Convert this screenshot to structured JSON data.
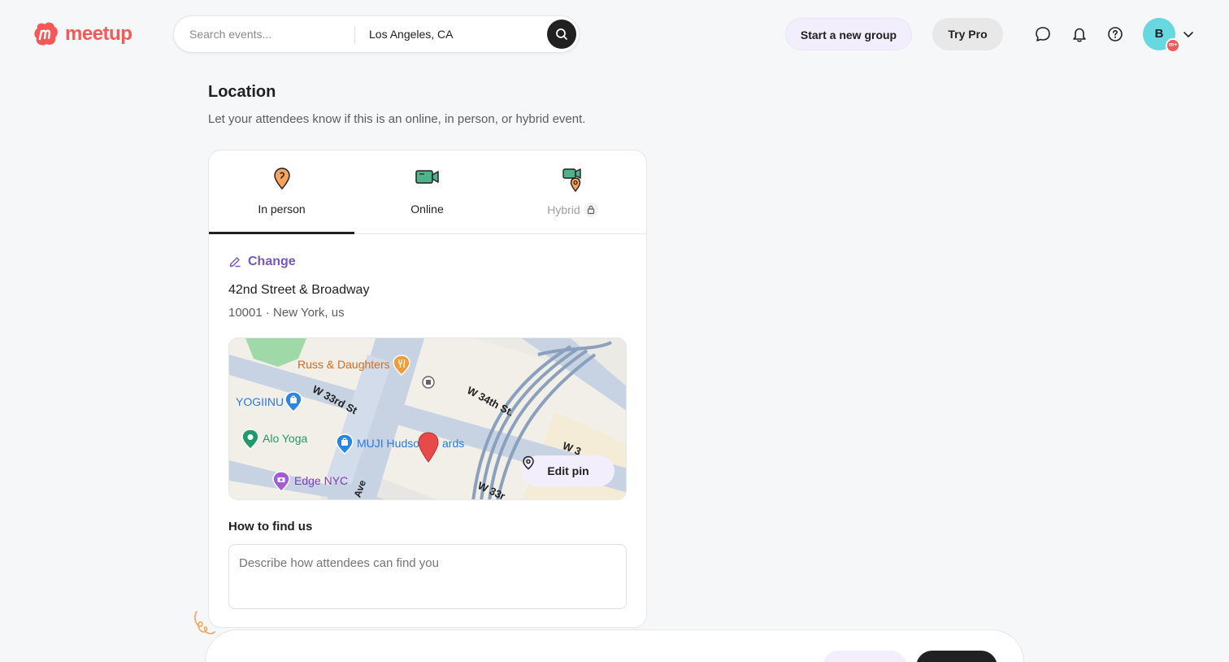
{
  "header": {
    "brand": "meetup",
    "search_placeholder": "Search events...",
    "location": "Los Angeles, CA",
    "start_group": "Start a new group",
    "try_pro": "Try Pro",
    "avatar_initial": "B",
    "avatar_badge": "m+"
  },
  "location_section": {
    "title": "Location",
    "subtitle": "Let your attendees know if this is an online, in person, or hybrid event.",
    "tabs": [
      {
        "label": "In person",
        "icon": "map-pin-icon",
        "active": true
      },
      {
        "label": "Online",
        "icon": "video-camera-icon",
        "active": false
      },
      {
        "label": "Hybrid",
        "icon": "hybrid-icon",
        "locked": true
      }
    ],
    "change_label": "Change",
    "address_line1": "42nd Street & Broadway",
    "address_line2": "10001 · New York, us",
    "map": {
      "labels": {
        "russ": "Russ & Daughters",
        "yogiinu": "YOGIINU",
        "alo": "Alo Yoga",
        "muji": "MUJI Hudso",
        "muji_tail": "ards",
        "edge": "Edge NYC",
        "w33": "W 33rd St",
        "w34": "W 34th St.",
        "w34b": "W 3",
        "w33b": "W 33r",
        "ave": "Ave"
      },
      "edit_pin": "Edit pin"
    },
    "find_us_title": "How to find us",
    "find_us_placeholder": "Describe how attendees can find you"
  },
  "colors": {
    "brand": "#f65858",
    "accent_purple": "#7556c4",
    "purple_bg": "#f3eefb"
  }
}
